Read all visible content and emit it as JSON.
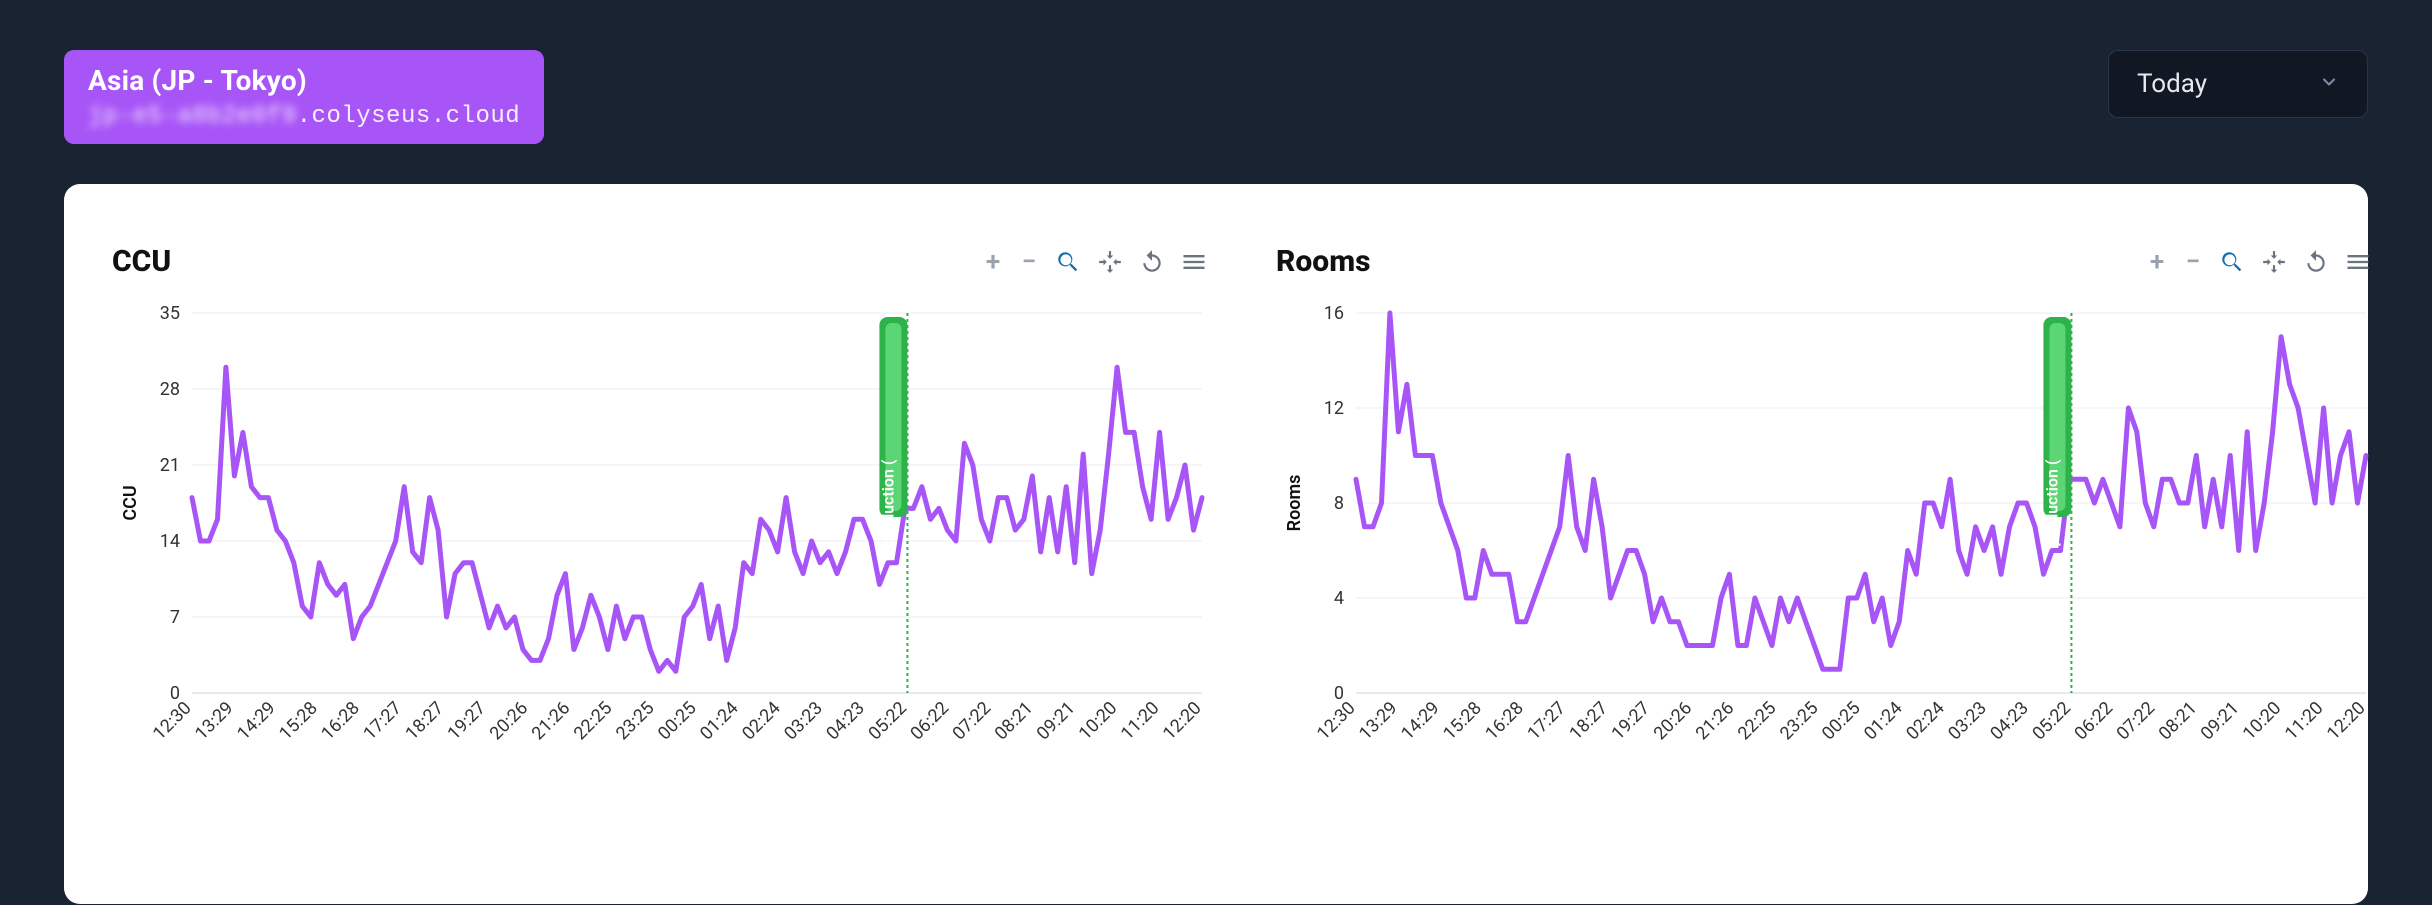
{
  "header": {
    "region_title": "Asia (JP - Tokyo)",
    "domain_blurred": "jp-e5-a8b2e0f9",
    "domain_suffix": ".colyseus.cloud"
  },
  "time_select": {
    "label": "Today"
  },
  "toolbar_icons": {
    "plus": "+",
    "minus": "−"
  },
  "charts": [
    {
      "id": "ccu",
      "title": "CCU",
      "ylabel": "CCU"
    },
    {
      "id": "rooms",
      "title": "Rooms",
      "ylabel": "Rooms"
    }
  ],
  "chart_data": [
    {
      "type": "line",
      "title": "CCU",
      "xlabel": "",
      "ylabel": "CCU",
      "ylim": [
        0,
        35
      ],
      "yticks": [
        0,
        7,
        14,
        21,
        28,
        35
      ],
      "xtick_labels": [
        "12:30",
        "13:29",
        "14:29",
        "15:28",
        "16:28",
        "17:27",
        "18:27",
        "19:27",
        "20:26",
        "21:26",
        "22:25",
        "23:25",
        "00:25",
        "01:24",
        "02:24",
        "03:23",
        "04:23",
        "05:22",
        "06:22",
        "07:22",
        "08:21",
        "09:21",
        "10:20",
        "11:20",
        "12:20"
      ],
      "annotation": {
        "label": "production (",
        "x_label": "05:22"
      },
      "series": [
        {
          "name": "CCU",
          "color": "#a855f7",
          "values": [
            18,
            14,
            14,
            16,
            30,
            20,
            24,
            19,
            18,
            18,
            15,
            14,
            12,
            8,
            7,
            12,
            10,
            9,
            10,
            5,
            7,
            8,
            10,
            12,
            14,
            19,
            13,
            12,
            18,
            15,
            7,
            11,
            12,
            12,
            9,
            6,
            8,
            6,
            7,
            4,
            3,
            3,
            5,
            9,
            11,
            4,
            6,
            9,
            7,
            4,
            8,
            5,
            7,
            7,
            4,
            2,
            3,
            2,
            7,
            8,
            10,
            5,
            8,
            3,
            6,
            12,
            11,
            16,
            15,
            13,
            18,
            13,
            11,
            14,
            12,
            13,
            11,
            13,
            16,
            16,
            14,
            10,
            12,
            12,
            17,
            17,
            19,
            16,
            17,
            15,
            14,
            23,
            21,
            16,
            14,
            18,
            18,
            15,
            16,
            20,
            13,
            18,
            13,
            19,
            12,
            22,
            11,
            15,
            22,
            30,
            24,
            24,
            19,
            16,
            24,
            16,
            18,
            21,
            15,
            18
          ]
        }
      ]
    },
    {
      "type": "line",
      "title": "Rooms",
      "xlabel": "",
      "ylabel": "Rooms",
      "ylim": [
        0,
        16
      ],
      "yticks": [
        0,
        4,
        8,
        12,
        16
      ],
      "xtick_labels": [
        "12:30",
        "13:29",
        "14:29",
        "15:28",
        "16:28",
        "17:27",
        "18:27",
        "19:27",
        "20:26",
        "21:26",
        "22:25",
        "23:25",
        "00:25",
        "01:24",
        "02:24",
        "03:23",
        "04:23",
        "05:22",
        "06:22",
        "07:22",
        "08:21",
        "09:21",
        "10:20",
        "11:20",
        "12:20"
      ],
      "annotation": {
        "label": "production (",
        "x_label": "05:22"
      },
      "series": [
        {
          "name": "Rooms",
          "color": "#a855f7",
          "values": [
            9,
            7,
            7,
            8,
            16,
            11,
            13,
            10,
            10,
            10,
            8,
            7,
            6,
            4,
            4,
            6,
            5,
            5,
            5,
            3,
            3,
            4,
            5,
            6,
            7,
            10,
            7,
            6,
            9,
            7,
            4,
            5,
            6,
            6,
            5,
            3,
            4,
            3,
            3,
            2,
            2,
            2,
            2,
            4,
            5,
            2,
            2,
            4,
            3,
            2,
            4,
            3,
            4,
            3,
            2,
            1,
            1,
            1,
            4,
            4,
            5,
            3,
            4,
            2,
            3,
            6,
            5,
            8,
            8,
            7,
            9,
            6,
            5,
            7,
            6,
            7,
            5,
            7,
            8,
            8,
            7,
            5,
            6,
            6,
            9,
            9,
            9,
            8,
            9,
            8,
            7,
            12,
            11,
            8,
            7,
            9,
            9,
            8,
            8,
            10,
            7,
            9,
            7,
            10,
            6,
            11,
            6,
            8,
            11,
            15,
            13,
            12,
            10,
            8,
            12,
            8,
            10,
            11,
            8,
            10
          ]
        }
      ]
    }
  ]
}
